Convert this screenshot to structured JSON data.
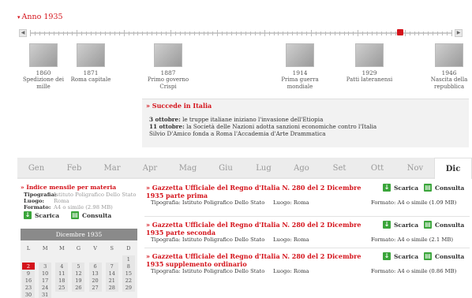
{
  "timeline": {
    "title": "Anno 1935",
    "events": [
      {
        "year": "1860",
        "label": "Spedizione dei mille"
      },
      {
        "year": "1871",
        "label": "Roma capitale"
      },
      {
        "year": "1887",
        "label": "Primo governo Crispi"
      },
      {
        "year": "1914",
        "label": "Prima guerra mondiale"
      },
      {
        "year": "1929",
        "label": "Patti lateranensi"
      },
      {
        "year": "1946",
        "label": "Nascita della repubblica"
      }
    ]
  },
  "succede": {
    "title": "Succede in Italia",
    "lines": [
      {
        "date": "3 ottobre:",
        "text": " le truppe italiane iniziano l'invasione dell'Etiopia"
      },
      {
        "date": "11 ottobre:",
        "text": " la Società delle Nazioni adotta sanzioni economiche contro l'Italia"
      },
      {
        "date": "",
        "text": "Silvio D'Amico fonda a Roma l'Accademia d'Arte Drammatica"
      }
    ]
  },
  "months": [
    "Gen",
    "Feb",
    "Mar",
    "Apr",
    "Mag",
    "Giu",
    "Lug",
    "Ago",
    "Set",
    "Ott",
    "Nov",
    "Dic"
  ],
  "active_month": "Dic",
  "indice": {
    "title": "Indice mensile per materia",
    "tipografia_label": "Tipografia:",
    "tipografia_value": "Istituto Poligrafico Dello Stato",
    "luogo_label": "Luogo:",
    "luogo_value": "Roma",
    "formato_label": "Formato:",
    "formato_value": "A4 o simile (2.98 MB)",
    "scarica": "Scarica",
    "consulta": "Consulta"
  },
  "calendar": {
    "title": "Dicembre 1935",
    "dow": [
      "L",
      "M",
      "M",
      "G",
      "V",
      "S",
      "D"
    ],
    "rows": [
      [
        "",
        "",
        "",
        "",
        "",
        "",
        "1"
      ],
      [
        "2",
        "3",
        "4",
        "5",
        "6",
        "7",
        "8"
      ],
      [
        "9",
        "10",
        "11",
        "12",
        "13",
        "14",
        "15"
      ],
      [
        "16",
        "17",
        "18",
        "19",
        "20",
        "21",
        "22"
      ],
      [
        "23",
        "24",
        "25",
        "26",
        "27",
        "28",
        "29"
      ],
      [
        "30",
        "31",
        "",
        "",
        "",
        "",
        ""
      ]
    ],
    "selected": "2"
  },
  "gazzette": [
    {
      "title": "Gazzetta Ufficiale del Regno d'Italia N. 280 del 2 Dicembre 1935 parte prima",
      "tipografia": "Tipografia: Istituto Poligrafico Dello Stato",
      "luogo": "Luogo: Roma",
      "formato": "Formato: A4 o simile (1.09 MB)",
      "scarica": "Scarica",
      "consulta": "Consulta"
    },
    {
      "title": "Gazzetta Ufficiale del Regno d'Italia N. 280 del 2 Dicembre 1935 parte seconda",
      "tipografia": "Tipografia: Istituto Poligrafico Dello Stato",
      "luogo": "Luogo: Roma",
      "formato": "Formato: A4 o simile (2.1 MB)",
      "scarica": "Scarica",
      "consulta": "Consulta"
    },
    {
      "title": "Gazzetta Ufficiale del Regno d'Italia N. 280 del 2 Dicembre 1935 supplemento ordinario",
      "tipografia": "Tipografia: Istituto Poligrafico Dello Stato",
      "luogo": "Luogo: Roma",
      "formato": "Formato: A4 o simile (0.86 MB)",
      "scarica": "Scarica",
      "consulta": "Consulta"
    }
  ],
  "colors": {
    "accent": "#d4131b",
    "button": "#3aa53a",
    "tabs_bg": "#ececec"
  }
}
